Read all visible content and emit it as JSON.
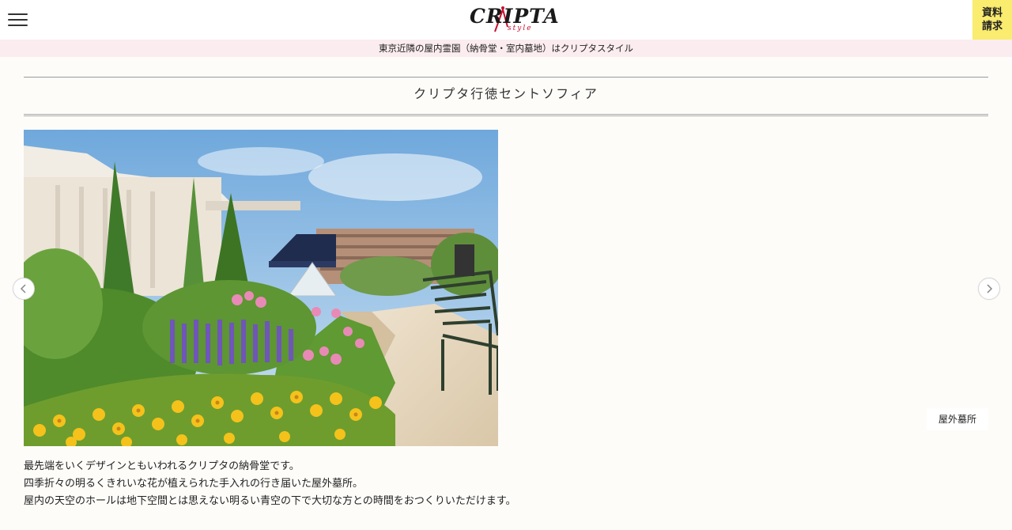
{
  "header": {
    "logo_text": "CRIPTA",
    "logo_sub": "style",
    "request_label": "資料請求"
  },
  "tagline": "東京近隣の屋内霊園（納骨堂・室内墓地）はクリプタスタイル",
  "page_title": "クリプタ行徳セントソフィア",
  "slider": {
    "caption": "屋外墓所"
  },
  "description": [
    "最先端をいくデザインともいわれるクリプタの納骨堂です。",
    "四季折々の明るくきれいな花が植えられた手入れの行き届いた屋外墓所。",
    "屋内の天空のホールは地下空間とは思えない明るい青空の下で大切な方との時間をおつくりいただけます。"
  ],
  "colors": {
    "request_bg": "#f9ec6e",
    "tagline_bg": "#fbecef",
    "logo_accent": "#c8102e"
  },
  "icons": {
    "menu": "hamburger-menu-icon",
    "prev": "chevron-left-icon",
    "next": "chevron-right-icon"
  }
}
